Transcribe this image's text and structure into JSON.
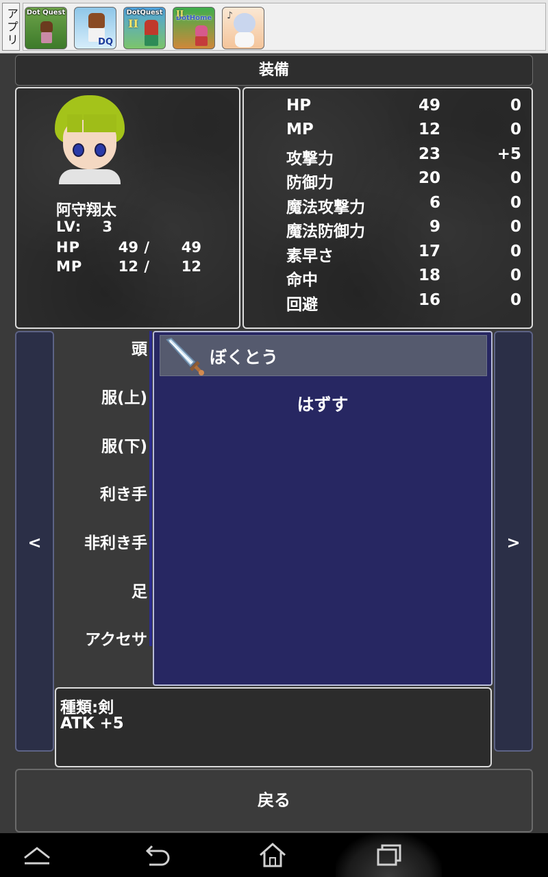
{
  "appbar": {
    "label": "アプリ",
    "apps": [
      {
        "name": "Dot Quest",
        "caption": "Dot Quest"
      },
      {
        "name": "DQ",
        "caption": "DQ"
      },
      {
        "name": "DotQuest II",
        "caption": "DotQuest",
        "numeral": "II"
      },
      {
        "name": "DotHome",
        "caption": "DotHome",
        "numeral": "II"
      },
      {
        "name": "character app",
        "caption": ""
      }
    ]
  },
  "screen": {
    "title": "装備"
  },
  "character": {
    "name": "阿守翔太",
    "lv_label": "LV:",
    "lv": "3",
    "hp_label": "HP",
    "hp_current": "49",
    "hp_max": "49",
    "mp_label": "MP",
    "mp_current": "12",
    "mp_max": "12",
    "separator": "/"
  },
  "stats": [
    {
      "label": "HP",
      "value": "49",
      "mod": "0"
    },
    {
      "label": "MP",
      "value": "12",
      "mod": "0"
    },
    {
      "label": "攻撃力",
      "value": "23",
      "mod": "+5"
    },
    {
      "label": "防御力",
      "value": "20",
      "mod": "0"
    },
    {
      "label": "魔法攻撃力",
      "value": "6",
      "mod": "0"
    },
    {
      "label": "魔法防御力",
      "value": "9",
      "mod": "0"
    },
    {
      "label": "素早さ",
      "value": "17",
      "mod": "0"
    },
    {
      "label": "命中",
      "value": "18",
      "mod": "0"
    },
    {
      "label": "回避",
      "value": "16",
      "mod": "0"
    }
  ],
  "nav": {
    "prev": "<",
    "next": ">"
  },
  "slots": [
    "頭",
    "服(上)",
    "服(下)",
    "利き手",
    "非利き手",
    "足",
    "アクセサ"
  ],
  "equipment": {
    "selected_item": "ぼくとう",
    "selected_icon": "sword-icon",
    "unequip_label": "はずす"
  },
  "description": {
    "line1": "種類:剣",
    "line2": "ATK  +5"
  },
  "back_button": "戻る",
  "colors": {
    "list_bg": "#272762",
    "selected_bg": "#555a6e",
    "nav_bg": "#2b2f47",
    "panel_bg": "#2c2c2c"
  }
}
